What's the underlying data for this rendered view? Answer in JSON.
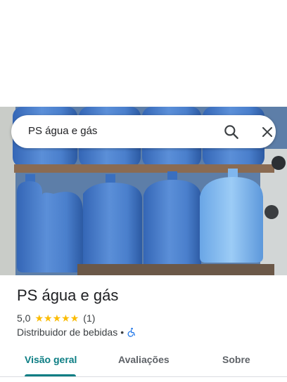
{
  "search": {
    "query": "PS água e gás",
    "search_icon": "search-icon",
    "close_icon": "close-icon"
  },
  "place": {
    "name": "PS água e gás",
    "rating": "5,0",
    "stars": 5,
    "review_count": "(1)",
    "category": "Distribuidor de bebidas",
    "separator": "•",
    "accessibility_icon": "wheelchair-icon"
  },
  "tabs": [
    {
      "label": "Visão geral",
      "active": true
    },
    {
      "label": "Avaliações",
      "active": false
    },
    {
      "label": "Sobre",
      "active": false
    }
  ],
  "colors": {
    "accent": "#0b7d83",
    "star": "#fbbc04",
    "accessibility": "#1a73e8"
  }
}
